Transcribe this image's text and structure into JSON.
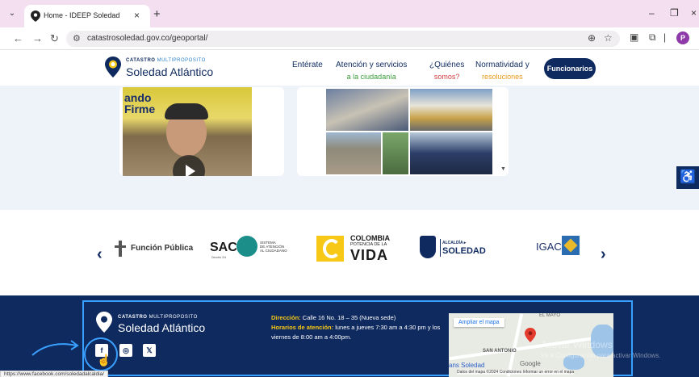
{
  "browser": {
    "tab_title": "Home - IDEEP Soledad",
    "url": "catastrosoledad.gov.co/geoportal/",
    "status_url": "https://www.facebook.com/soledadalcaldia/"
  },
  "header": {
    "logo_top_bold": "CATASTRO",
    "logo_top_light": "MULTIPROPOSITO",
    "logo_main": "Soledad Atlántico",
    "nav": [
      {
        "label": "Entérate",
        "sub": ""
      },
      {
        "label": "Atención y servicios",
        "sub": "a la ciudadanía"
      },
      {
        "label": "¿Quiénes",
        "sub": "somos?"
      },
      {
        "label": "Normatividad y",
        "sub": "resoluciones"
      }
    ],
    "cta": "Funcionarios"
  },
  "content": {
    "video_text": "ando\nFirme"
  },
  "partners": {
    "funcion_publica": "Función Pública",
    "sac": "SAC",
    "sac_desc": "SISTEMA\nDE ATENCIÓN\nAL CIUDADANO",
    "sac_sub": "Decreto 2/4",
    "colombia": "COLOMBIA",
    "colombia_sub": "POTENCIA DE LA",
    "vida": "VIDA",
    "alcaldia_small": "ALCALDÍA ▸",
    "alcaldia": "SOLEDAD",
    "igac": "IGAC"
  },
  "footer": {
    "logo_top_bold": "CATASTRO",
    "logo_top_light": "MULTIPROPOSITO",
    "logo_main": "Soledad Atlántico",
    "address_label": "Dirección:",
    "address": "Calle 16 No. 18 – 35 (Nueva sede)",
    "hours_label": "Horarios de atención:",
    "hours": "lunes a jueves 7:30 am a 4:30 pm y los viernes de 8:00 am a 4:00pm."
  },
  "map": {
    "expand": "Ampliar el mapa",
    "label_san_antonio": "SAN ANTONIO",
    "label_top": "EL MAYO",
    "soledad": "ans Soledad",
    "google": "Google",
    "attribution": "Datos del mapa ©2024   Condiciones   Informar un error en el mapa"
  },
  "overlay": {
    "windows_1": "Activar Windows",
    "windows_2": "Ve a Configuración para activar Windows."
  },
  "colors": {
    "navy": "#0f2a5f",
    "highlight": "#3aa0ff",
    "yellow": "#f7c815"
  }
}
